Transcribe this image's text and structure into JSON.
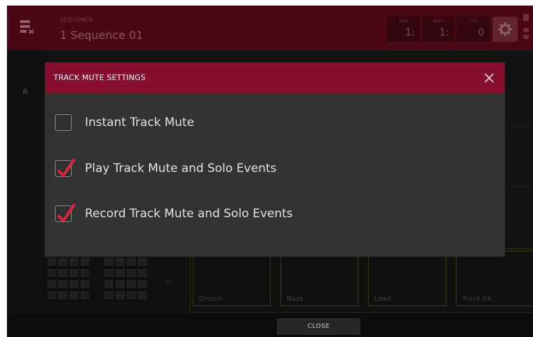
{
  "colors": {
    "accent": "#870f2d",
    "check": "#e0223f",
    "dialog_bg": "#323232",
    "pad_border": "#3b3a18"
  },
  "header": {
    "caption": "SEQUENCE",
    "sequence_name": "1  Sequence 01",
    "time": [
      {
        "caption": "BAR",
        "value": "1:"
      },
      {
        "caption": "BEAT",
        "value": "1:"
      },
      {
        "caption": "TICK",
        "value": "0"
      }
    ],
    "icons": [
      "sequence-list-icon",
      "gear-icon",
      "battery-icon"
    ]
  },
  "background": {
    "rows": [
      "A",
      "",
      "",
      ""
    ],
    "mini_grid_letter": "H",
    "pads": [
      {
        "label": "Drums"
      },
      {
        "label": "Bass"
      },
      {
        "label": "Lead"
      },
      {
        "label": "Track 04"
      }
    ]
  },
  "dialog": {
    "title": "TRACK MUTE SETTINGS",
    "close_icon": "close-icon",
    "options": [
      {
        "label": "Instant Track Mute",
        "checked": false
      },
      {
        "label": "Play Track Mute and Solo Events",
        "checked": true
      },
      {
        "label": "Record Track Mute and Solo Events",
        "checked": true
      }
    ]
  },
  "footer": {
    "close_label": "CLOSE"
  }
}
